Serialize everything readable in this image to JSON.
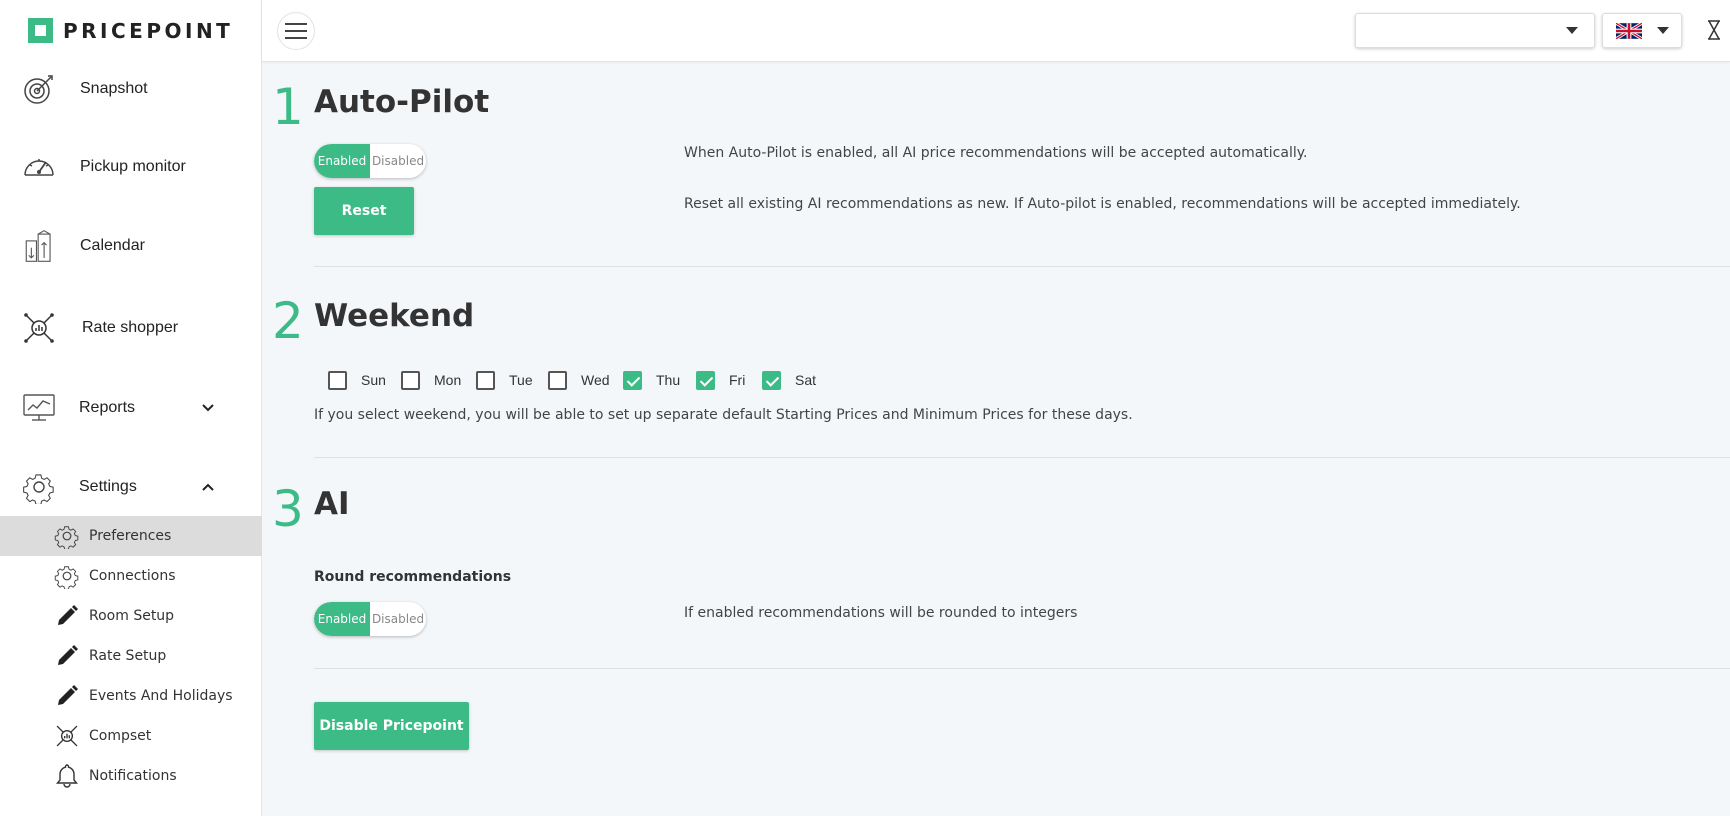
{
  "brand": {
    "name": "PRICEPOINT",
    "accent": "#3dbb87"
  },
  "sidebar": {
    "items": [
      {
        "label": "Snapshot",
        "icon": "target-icon"
      },
      {
        "label": "Pickup monitor",
        "icon": "speedometer-icon"
      },
      {
        "label": "Calendar",
        "icon": "calendar-buildings-icon"
      },
      {
        "label": "Rate shopper",
        "icon": "rate-shopper-icon"
      },
      {
        "label": "Reports",
        "icon": "chart-monitor-icon",
        "expanded": false
      },
      {
        "label": "Settings",
        "icon": "gear-icon",
        "expanded": true
      }
    ],
    "sub_items": [
      {
        "label": "Preferences",
        "icon": "gear-icon",
        "active": true
      },
      {
        "label": "Connections",
        "icon": "gear-icon"
      },
      {
        "label": "Room Setup",
        "icon": "pencil-icon"
      },
      {
        "label": "Rate Setup",
        "icon": "pencil-icon"
      },
      {
        "label": "Events And Holidays",
        "icon": "pencil-icon"
      },
      {
        "label": "Compset",
        "icon": "rate-shopper-icon"
      },
      {
        "label": "Notifications",
        "icon": "bell-icon"
      }
    ]
  },
  "topbar": {
    "property_select_value": "",
    "language": "en-GB"
  },
  "sections": {
    "autopilot": {
      "number": "1",
      "title": "Auto-Pilot",
      "toggle_on": "Enabled",
      "toggle_off": "Disabled",
      "state": "Enabled",
      "toggle_desc": "When Auto-Pilot is enabled, all AI price recommendations will be accepted automatically.",
      "reset_label": "Reset",
      "reset_desc": "Reset all existing AI recommendations as new. If Auto-pilot is enabled, recommendations will be accepted immediately."
    },
    "weekend": {
      "number": "2",
      "title": "Weekend",
      "days": [
        {
          "label": "Sun",
          "checked": false
        },
        {
          "label": "Mon",
          "checked": false
        },
        {
          "label": "Tue",
          "checked": false
        },
        {
          "label": "Wed",
          "checked": false
        },
        {
          "label": "Thu",
          "checked": true
        },
        {
          "label": "Fri",
          "checked": true
        },
        {
          "label": "Sat",
          "checked": true
        }
      ],
      "desc": "If you select weekend, you will be able to set up separate default Starting Prices and Minimum Prices for these days."
    },
    "ai": {
      "number": "3",
      "title": "AI",
      "round_label": "Round recommendations",
      "toggle_on": "Enabled",
      "toggle_off": "Disabled",
      "state": "Enabled",
      "desc": "If enabled recommendations will be rounded to integers"
    }
  },
  "disable_button": "Disable Pricepoint"
}
